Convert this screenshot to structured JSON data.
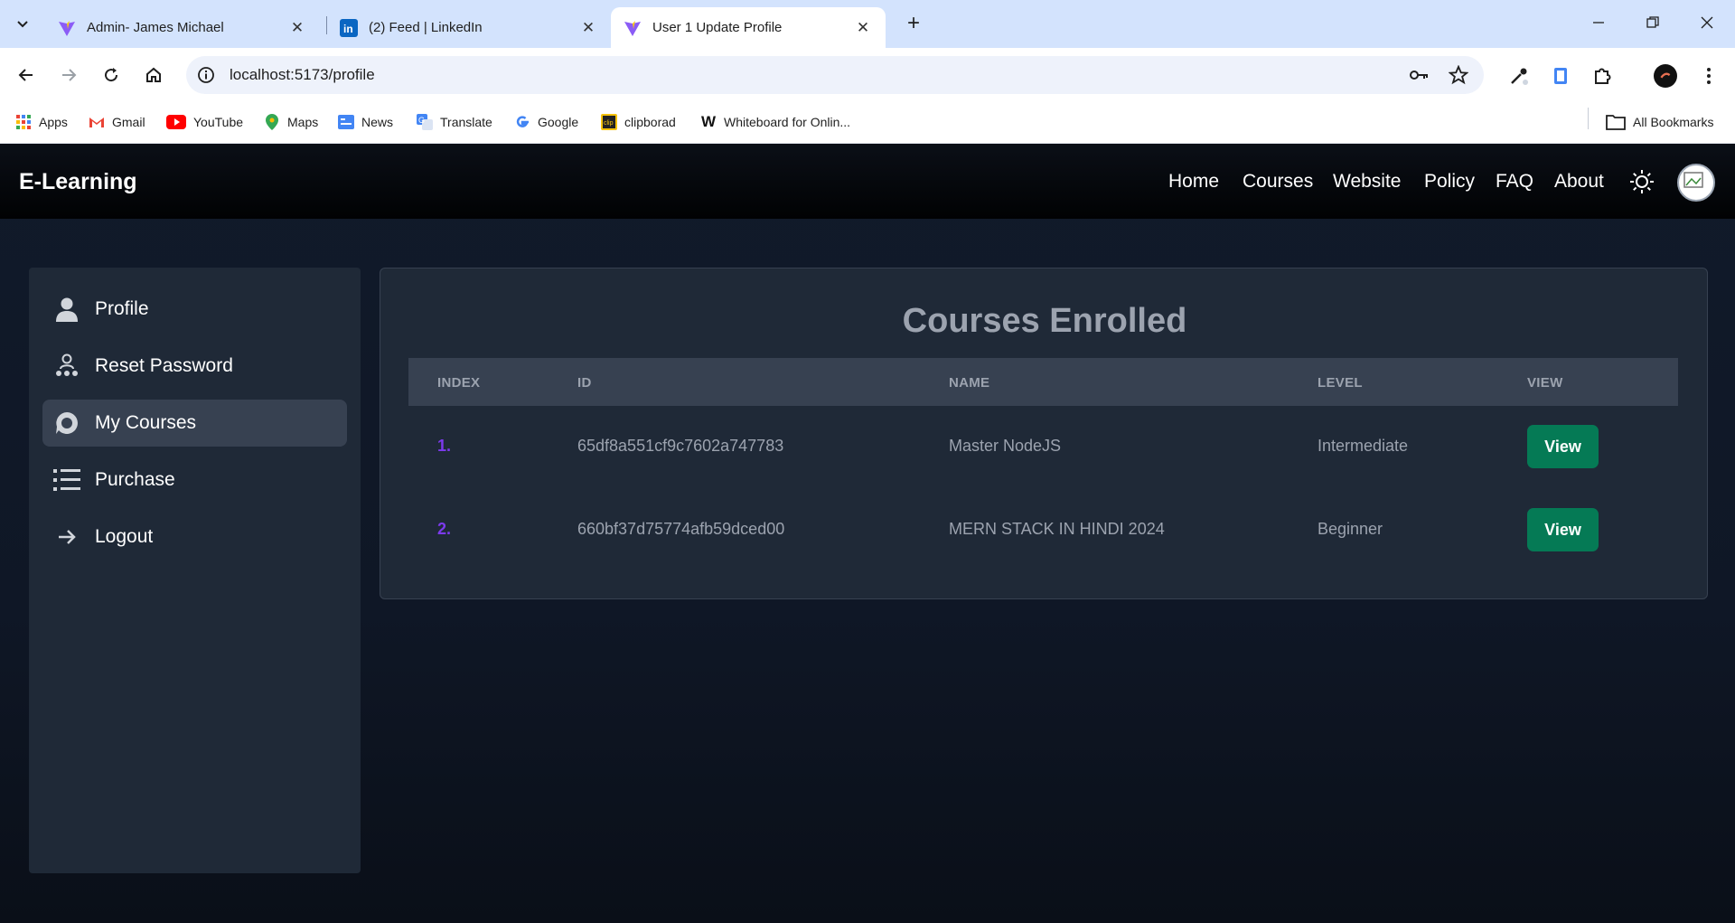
{
  "browser": {
    "tabs": [
      {
        "label": "Admin- James Michael",
        "icon": "vite-icon"
      },
      {
        "label": "(2) Feed | LinkedIn",
        "icon": "linkedin-icon"
      },
      {
        "label": "User 1 Update Profile",
        "icon": "vite-icon",
        "active": true
      }
    ],
    "url": "localhost:5173/profile",
    "bookmarks": [
      {
        "label": "Apps"
      },
      {
        "label": "Gmail"
      },
      {
        "label": "YouTube"
      },
      {
        "label": "Maps"
      },
      {
        "label": "News"
      },
      {
        "label": "Translate"
      },
      {
        "label": "Google"
      },
      {
        "label": "clipborad"
      },
      {
        "label": "Whiteboard for Onlin..."
      }
    ],
    "all_bookmarks": "All Bookmarks"
  },
  "app": {
    "brand": "E-Learning",
    "nav": [
      "Home",
      "Courses",
      "Website",
      "Policy",
      "FAQ",
      "About"
    ]
  },
  "sidebar": {
    "items": [
      {
        "label": "Profile",
        "icon": "user-icon"
      },
      {
        "label": "Reset Password",
        "icon": "users-reset-icon"
      },
      {
        "label": "My Courses",
        "icon": "chat-bubble-icon",
        "active": true
      },
      {
        "label": "Purchase",
        "icon": "list-icon"
      },
      {
        "label": "Logout",
        "icon": "arrow-right-icon"
      }
    ]
  },
  "courses": {
    "title": "Courses Enrolled",
    "columns": [
      "INDEX",
      "ID",
      "NAME",
      "LEVEL",
      "VIEW"
    ],
    "rows": [
      {
        "index": "1.",
        "id": "65df8a551cf9c7602a747783",
        "name": "Master NodeJS",
        "level": "Intermediate",
        "view": "View"
      },
      {
        "index": "2.",
        "id": "660bf37d75774afb59dced00",
        "name": "MERN STACK IN HINDI 2024",
        "level": "Beginner",
        "view": "View"
      }
    ]
  },
  "colors": {
    "accent_green": "#057a55",
    "index_purple": "#7c3aed",
    "panel_bg": "#1f2937"
  }
}
